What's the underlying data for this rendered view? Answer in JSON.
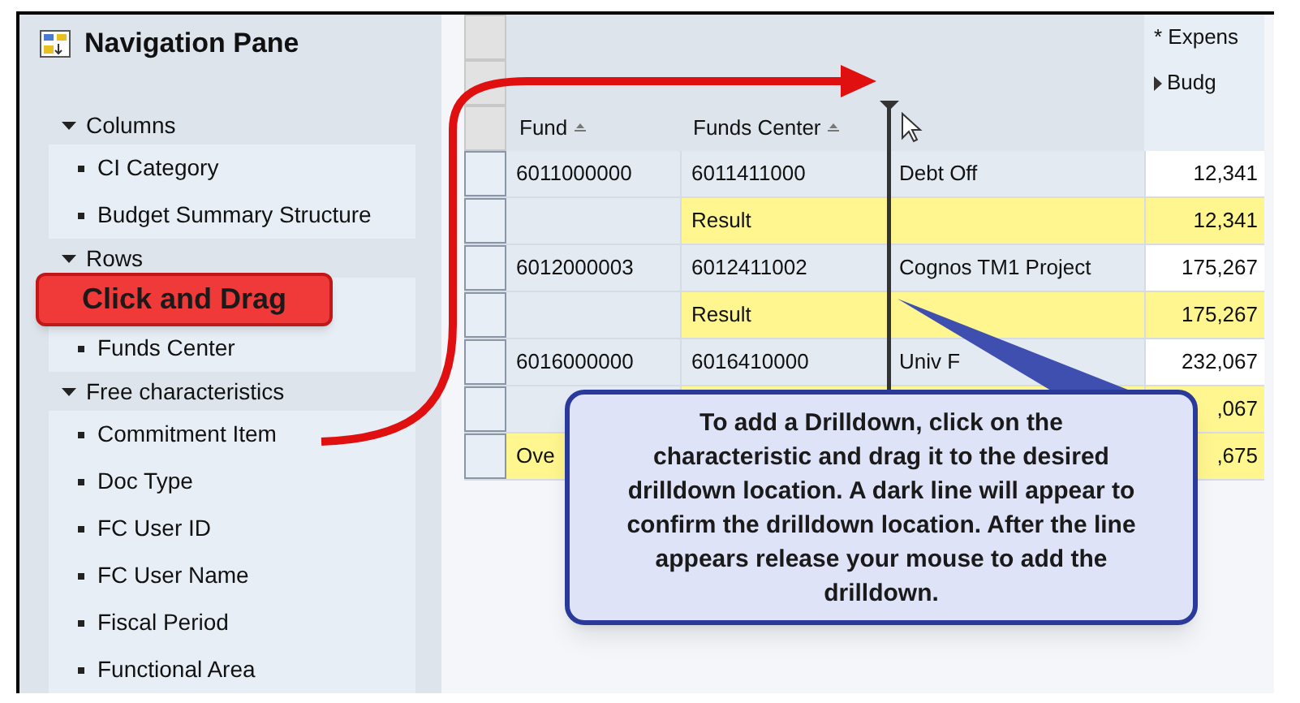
{
  "navigation_pane": {
    "title": "Navigation Pane",
    "sections": [
      {
        "label": "Columns",
        "expanded": true,
        "items": [
          "CI Category",
          "Budget Summary Structure"
        ]
      },
      {
        "label": "Rows",
        "expanded": true,
        "items": [
          "Funds Center"
        ]
      },
      {
        "label": "Free characteristics",
        "expanded": true,
        "items": [
          "Commitment Item",
          "Doc Type",
          "FC User ID",
          "FC User Name",
          "Fiscal Period",
          "Functional Area"
        ]
      }
    ]
  },
  "table": {
    "header_rows": [
      "* Expens",
      "Budg"
    ],
    "columns": [
      "Fund",
      "Funds Center"
    ],
    "rows": [
      {
        "kind": "data",
        "cells": [
          "6011000000",
          "6011411000",
          "Debt Off",
          "12,341"
        ]
      },
      {
        "kind": "result",
        "cells": [
          "",
          "Result",
          "",
          "12,341"
        ]
      },
      {
        "kind": "data",
        "cells": [
          "6012000003",
          "6012411002",
          "Cognos TM1 Project",
          "175,267"
        ]
      },
      {
        "kind": "result",
        "cells": [
          "",
          "Result",
          "",
          "175,267"
        ]
      },
      {
        "kind": "data",
        "cells": [
          "6016000000",
          "6016410000",
          "Univ F",
          "232,067"
        ]
      },
      {
        "kind": "result",
        "cells": [
          "",
          "",
          "",
          ",067"
        ]
      },
      {
        "kind": "total",
        "cells": [
          "Ove",
          "",
          "",
          ",675"
        ]
      }
    ]
  },
  "callouts": [
    {
      "kind": "red",
      "text": "Click and Drag"
    },
    {
      "kind": "blue",
      "text": "To add a Drilldown, click on the characteristic and drag it to the desired drilldown location. A dark line will appear to confirm the drilldown location. After the line appears release your mouse to add the drilldown."
    }
  ]
}
